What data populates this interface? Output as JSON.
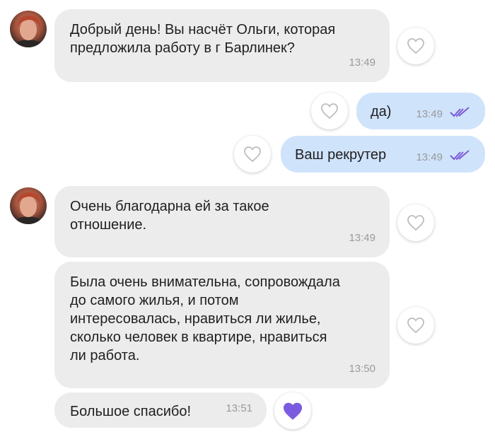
{
  "colors": {
    "incoming_bubble": "#ececec",
    "outgoing_bubble": "#cfe3fb",
    "read_ticks": "#7a5ad9",
    "liked_heart": "#7b5ce0",
    "heart_outline": "#bdbdbd",
    "timestamp": "#9a9a9a"
  },
  "messages": [
    {
      "direction": "incoming",
      "text": "Добрый день! Вы насчёт Ольги, которая\nпредложила работу в г Барлинек?",
      "time": "13:49",
      "liked": false
    },
    {
      "direction": "outgoing",
      "text": "да)",
      "time": "13:49",
      "status": "read",
      "liked": false
    },
    {
      "direction": "outgoing",
      "text": "Ваш рекрутер",
      "time": "13:49",
      "status": "read",
      "liked": false
    },
    {
      "direction": "incoming",
      "text": "Очень благодарна ей за такое\nотношение.",
      "time": "13:49",
      "liked": false
    },
    {
      "direction": "incoming",
      "text": "Была очень внимательна, сопровождала\nдо самого жилья, и потом\nинтересовалась, нравиться ли жилье,\nсколько человек в квартире, нравиться\nли работа.",
      "time": "13:50",
      "liked": false
    },
    {
      "direction": "incoming",
      "text": "Большое спасибо!",
      "time": "13:51",
      "liked": true
    }
  ]
}
